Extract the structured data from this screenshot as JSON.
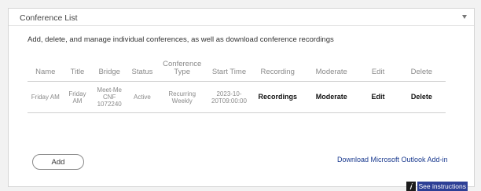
{
  "panel": {
    "title": "Conference List",
    "description": "Add, delete, and manage individual conferences, as well as download conference recordings"
  },
  "table": {
    "columns": [
      "Name",
      "Title",
      "Bridge",
      "Status",
      "Conference Type",
      "Start Time",
      "Recording",
      "Moderate",
      "Edit",
      "Delete"
    ],
    "rows": [
      {
        "name": "Friday AM",
        "title": "Friday AM",
        "bridge": "Meet-Me CNF 1072240",
        "status": "Active",
        "conference_type": "Recurring Weekly",
        "start_time": "2023-10-20T09:00:00",
        "recording": "Recordings",
        "moderate": "Moderate",
        "edit": "Edit",
        "delete": "Delete"
      }
    ]
  },
  "actions": {
    "add_label": "Add",
    "outlook_link": "Download Microsoft Outlook Add-in",
    "instructions_label": "See instructions"
  },
  "icons": {
    "collapse": "chevron-down-icon",
    "info": "info-icon"
  },
  "colors": {
    "link": "#1a3a8f",
    "instructions_bg": "#2d3f95"
  }
}
